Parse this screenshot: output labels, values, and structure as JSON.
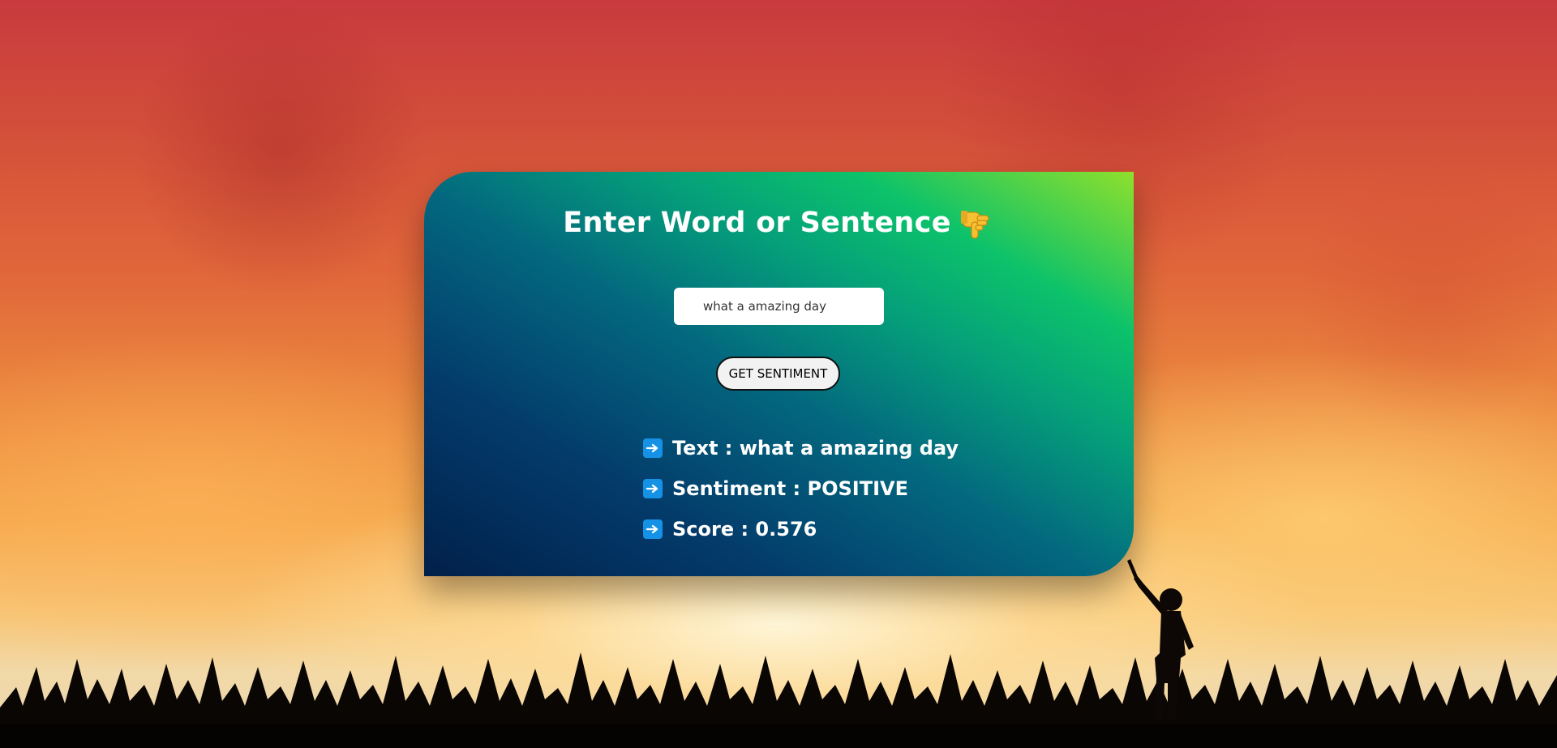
{
  "colors": {
    "card_gradient_start": "#02204a",
    "card_gradient_end": "#8fe02c",
    "button_bg": "#f2f2f2",
    "arrow_icon_bg": "#1592e6"
  },
  "header": {
    "title": "Enter Word or Sentence",
    "title_icon": "pointing-down-hand-icon"
  },
  "form": {
    "input_value": "what a amazing day",
    "button_label": "GET SENTIMENT"
  },
  "results": [
    {
      "icon": "right-arrow-icon",
      "text": "Text : what a amazing day"
    },
    {
      "icon": "right-arrow-icon",
      "text": "Sentiment : POSITIVE"
    },
    {
      "icon": "right-arrow-icon",
      "text": "Score : 0.576"
    }
  ]
}
